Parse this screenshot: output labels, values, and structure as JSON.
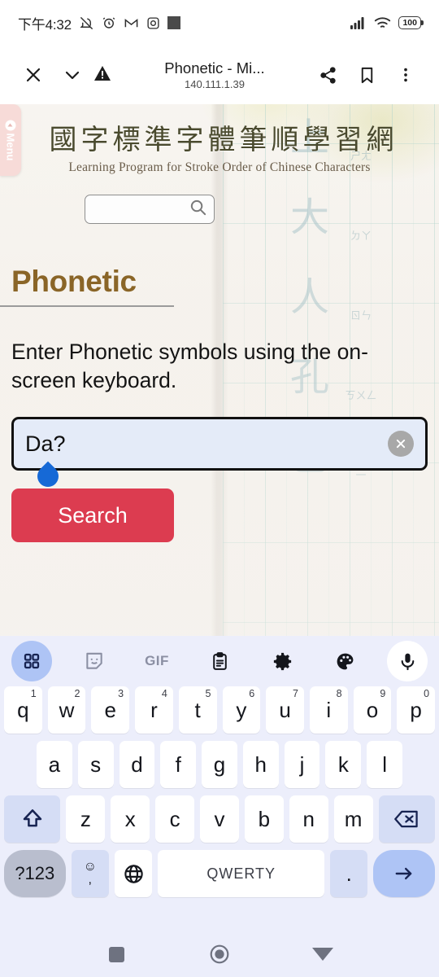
{
  "status_bar": {
    "time": "下午4:32",
    "battery_percent": "100",
    "icons": [
      "mute-icon",
      "alarm-icon",
      "gmail-icon",
      "instagram-icon",
      "app-square-icon",
      "signal-icon",
      "wifi-icon",
      "battery-icon"
    ]
  },
  "browser_bar": {
    "close_label": "close-icon",
    "collapse_label": "chevron-down-icon",
    "security_label": "warning-triangle-icon",
    "title": "Phonetic - Mi...",
    "url": "140.111.1.39",
    "share_label": "share-icon",
    "bookmark_label": "bookmark-icon",
    "overflow_label": "more-vertical-icon"
  },
  "page": {
    "menu_tab_label": "Menu",
    "site_title": "國字標準字體筆順學習網",
    "site_subtitle": "Learning Program for Stroke Order of Chinese Characters",
    "site_search": {
      "value": "",
      "placeholder": ""
    },
    "heading": "Phonetic",
    "instruction": "Enter Phonetic symbols using the on-screen keyboard.",
    "phonetic_input": {
      "value": "Da?",
      "placeholder": ""
    },
    "clear_label": "clear-icon",
    "search_button": "Search",
    "background_characters": [
      "上",
      "大",
      "人",
      "孔",
      "乙"
    ],
    "background_bopomofo": [
      "ㄕㄤ",
      "ㄉㄚ",
      "ㄖㄣ",
      "ㄎㄨㄥ",
      "一"
    ],
    "accent_heading_color": "#8a6527",
    "accent_button_color": "#dc3c50",
    "input_background_color": "#e4ebf8"
  },
  "keyboard": {
    "toolbar": [
      {
        "name": "apps-grid-icon",
        "label": "",
        "active": true
      },
      {
        "name": "sticker-icon",
        "label": ""
      },
      {
        "name": "gif-icon",
        "label": "GIF"
      },
      {
        "name": "clipboard-icon",
        "label": ""
      },
      {
        "name": "gear-icon",
        "label": ""
      },
      {
        "name": "palette-icon",
        "label": ""
      },
      {
        "name": "microphone-icon",
        "label": ""
      }
    ],
    "row1": [
      {
        "key": "q",
        "sup": "1"
      },
      {
        "key": "w",
        "sup": "2"
      },
      {
        "key": "e",
        "sup": "3"
      },
      {
        "key": "r",
        "sup": "4"
      },
      {
        "key": "t",
        "sup": "5"
      },
      {
        "key": "y",
        "sup": "6"
      },
      {
        "key": "u",
        "sup": "7"
      },
      {
        "key": "i",
        "sup": "8"
      },
      {
        "key": "o",
        "sup": "9"
      },
      {
        "key": "p",
        "sup": "0"
      }
    ],
    "row2": [
      {
        "key": "a"
      },
      {
        "key": "s"
      },
      {
        "key": "d"
      },
      {
        "key": "f"
      },
      {
        "key": "g"
      },
      {
        "key": "h"
      },
      {
        "key": "j"
      },
      {
        "key": "k"
      },
      {
        "key": "l"
      }
    ],
    "row3_shift": "shift-icon",
    "row3": [
      {
        "key": "z"
      },
      {
        "key": "x"
      },
      {
        "key": "c"
      },
      {
        "key": "v"
      },
      {
        "key": "b"
      },
      {
        "key": "n"
      },
      {
        "key": "m"
      }
    ],
    "row3_backspace": "backspace-icon",
    "row4": {
      "symbols_label": "?123",
      "emoji_label": "☺",
      "emoji_sub": ",",
      "globe_label": "globe-icon",
      "space_label": "QWERTY",
      "period_label": ".",
      "enter_label": "arrow-right-icon"
    }
  },
  "nav_bar": {
    "recents_label": "recents-square-icon",
    "home_label": "home-circle-icon",
    "hide_keyboard_label": "hide-keyboard-triangle-icon"
  }
}
